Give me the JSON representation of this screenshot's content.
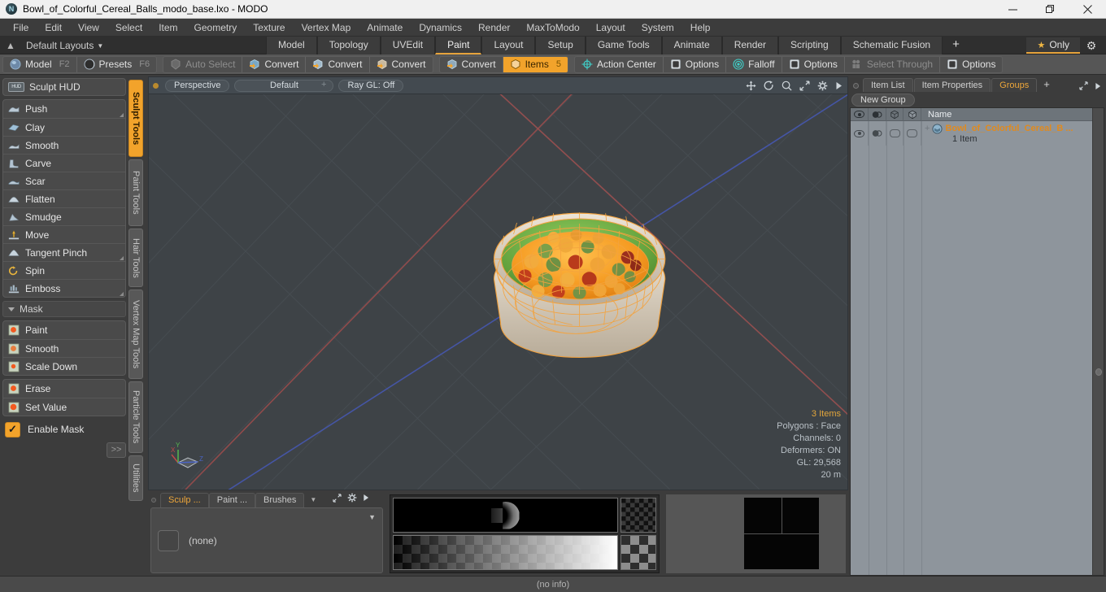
{
  "window": {
    "title": "Bowl_of_Colorful_Cereal_Balls_modo_base.lxo - MODO",
    "app_icon": "modo-logo-icon",
    "minimize": "minimize-icon",
    "maximize": "restore-icon",
    "close": "close-icon"
  },
  "menubar": {
    "items": [
      "File",
      "Edit",
      "View",
      "Select",
      "Item",
      "Geometry",
      "Texture",
      "Vertex Map",
      "Animate",
      "Dynamics",
      "Render",
      "MaxToModo",
      "Layout",
      "System",
      "Help"
    ]
  },
  "layoutbar": {
    "home_icon": "home-icon",
    "layouts_label": "Default Layouts",
    "tabs": [
      {
        "label": "Model",
        "active": false
      },
      {
        "label": "Topology",
        "active": false
      },
      {
        "label": "UVEdit",
        "active": false
      },
      {
        "label": "Paint",
        "active": true
      },
      {
        "label": "Layout",
        "active": false
      },
      {
        "label": "Setup",
        "active": false
      },
      {
        "label": "Game Tools",
        "active": false
      },
      {
        "label": "Animate",
        "active": false
      },
      {
        "label": "Render",
        "active": false
      },
      {
        "label": "Scripting",
        "active": false
      },
      {
        "label": "Schematic Fusion",
        "active": false
      }
    ],
    "add_tab": "+",
    "only_label": "Only",
    "star_icon": "star-icon",
    "gear_icon": "gear-icon"
  },
  "toolbar": {
    "mode_group": [
      {
        "label": "Model",
        "shortcut": "F2",
        "icon": "sphere-icon"
      },
      {
        "label": "Presets",
        "shortcut": "F6",
        "icon": "preset-icon"
      }
    ],
    "select_group": [
      {
        "label": "Auto Select",
        "icon": "auto-select-icon",
        "disabled": true
      },
      {
        "label": "Convert",
        "icon": "convert-vertex-icon",
        "disabled": false
      },
      {
        "label": "Convert",
        "icon": "convert-edge-icon",
        "disabled": false
      },
      {
        "label": "Convert",
        "icon": "convert-polygon-icon",
        "disabled": false
      }
    ],
    "items_group": [
      {
        "label": "Convert",
        "icon": "convert-item-icon",
        "active": false
      },
      {
        "label": "Items",
        "icon": "item-cube-icon",
        "active": true,
        "badge": "5"
      }
    ],
    "action_group": [
      {
        "label": "Action Center",
        "icon": "action-center-icon"
      },
      {
        "label": "Options",
        "icon": "options-box-icon"
      },
      {
        "label": "Falloff",
        "icon": "falloff-icon"
      },
      {
        "label": "Options",
        "icon": "options-box-icon"
      },
      {
        "label": "Select Through",
        "icon": "select-through-icon",
        "disabled": true
      },
      {
        "label": "Options",
        "icon": "options-box-icon"
      }
    ]
  },
  "left_panel": {
    "hud_button": {
      "label": "Sculpt HUD",
      "icon": "hud-icon"
    },
    "sculpt_tools": [
      {
        "label": "Push",
        "icon": "push-icon",
        "has_corner": true
      },
      {
        "label": "Clay",
        "icon": "clay-icon",
        "has_corner": false
      },
      {
        "label": "Smooth",
        "icon": "smooth-icon",
        "has_corner": false
      },
      {
        "label": "Carve",
        "icon": "carve-icon",
        "has_corner": false
      },
      {
        "label": "Scar",
        "icon": "scar-icon",
        "has_corner": false
      },
      {
        "label": "Flatten",
        "icon": "flatten-icon",
        "has_corner": false
      },
      {
        "label": "Smudge",
        "icon": "smudge-icon",
        "has_corner": false
      },
      {
        "label": "Move",
        "icon": "move-icon",
        "has_corner": false
      },
      {
        "label": "Tangent Pinch",
        "icon": "tangent-pinch-icon",
        "has_corner": true
      },
      {
        "label": "Spin",
        "icon": "spin-icon",
        "has_corner": false
      },
      {
        "label": "Emboss",
        "icon": "emboss-icon",
        "has_corner": true
      }
    ],
    "mask_section": {
      "title": "Mask",
      "group_a": [
        {
          "label": "Paint",
          "icon": "mask-paint-icon"
        },
        {
          "label": "Smooth",
          "icon": "mask-smooth-icon"
        },
        {
          "label": "Scale Down",
          "icon": "mask-scale-down-icon"
        }
      ],
      "group_b": [
        {
          "label": "Erase",
          "icon": "mask-erase-icon"
        },
        {
          "label": "Set Value",
          "icon": "mask-set-value-icon"
        }
      ],
      "enable_mask": {
        "label": "Enable Mask",
        "checked": true,
        "icon": "checkmark-icon"
      },
      "expand_label": ">>"
    },
    "vertical_tabs": [
      {
        "label": "Sculpt Tools",
        "active": true
      },
      {
        "label": "Paint Tools",
        "active": false
      },
      {
        "label": "Hair Tools",
        "active": false
      },
      {
        "label": "Vertex Map Tools",
        "active": false
      },
      {
        "label": "Particle Tools",
        "active": false
      },
      {
        "label": "Utilities",
        "active": false
      }
    ]
  },
  "viewport": {
    "header": {
      "view_mode": "Perspective",
      "shading": "Default",
      "raygl": "Ray GL: Off",
      "icons": [
        "move-icon",
        "rotate-icon",
        "zoom-icon",
        "fit-icon",
        "gear-icon",
        "play-icon"
      ]
    },
    "stats": {
      "items": "3 Items",
      "polygons": "Polygons : Face",
      "channels": "Channels: 0",
      "deformers": "Deformers: ON",
      "gl": "GL: 29,568",
      "scale": "20 m"
    },
    "axis_gizmo": {
      "x": "X",
      "y": "Y",
      "z": "Z"
    },
    "colors": {
      "background": "#3e4347",
      "grid": "#474d52",
      "axis_x": "#9c5050",
      "axis_z": "#4a55a8",
      "wireframe": "#f0a03c",
      "bowl_interior": "#78b24a",
      "bowl_exterior": "#d9cfc1",
      "cereal": "#f5a623"
    }
  },
  "bottom_panel": {
    "tabs": [
      {
        "label": "Sculp ...",
        "active": true
      },
      {
        "label": "Paint ...",
        "active": false
      },
      {
        "label": "Brushes",
        "active": false
      }
    ],
    "dropdown_caret": "chevron-down-icon",
    "tools": [
      "fit-icon",
      "gear-icon",
      "play-icon"
    ],
    "preset_value": "(none)",
    "swatch": "empty-swatch"
  },
  "right_panel": {
    "tabs": [
      {
        "label": "Item List",
        "active": false
      },
      {
        "label": "Item Properties",
        "active": false
      },
      {
        "label": "Groups",
        "active": true
      }
    ],
    "add_tab": "+",
    "tools": [
      "fit-icon",
      "play-icon"
    ],
    "new_group_button": "New Group",
    "columns": {
      "visible_icon": "eye-icon",
      "shade_icon": "shading-icon",
      "wire_icon": "wireframe-cube-icon",
      "render_icon": "render-cube-icon",
      "name": "Name"
    },
    "rows": [
      {
        "name": "Bowl_of_Colorful_Cereal_B ...",
        "sub": "1 Item",
        "icon": "group-item-icon",
        "expand": "+",
        "visible": true,
        "selected": true
      }
    ]
  },
  "statusbar": {
    "text": "(no info)"
  }
}
